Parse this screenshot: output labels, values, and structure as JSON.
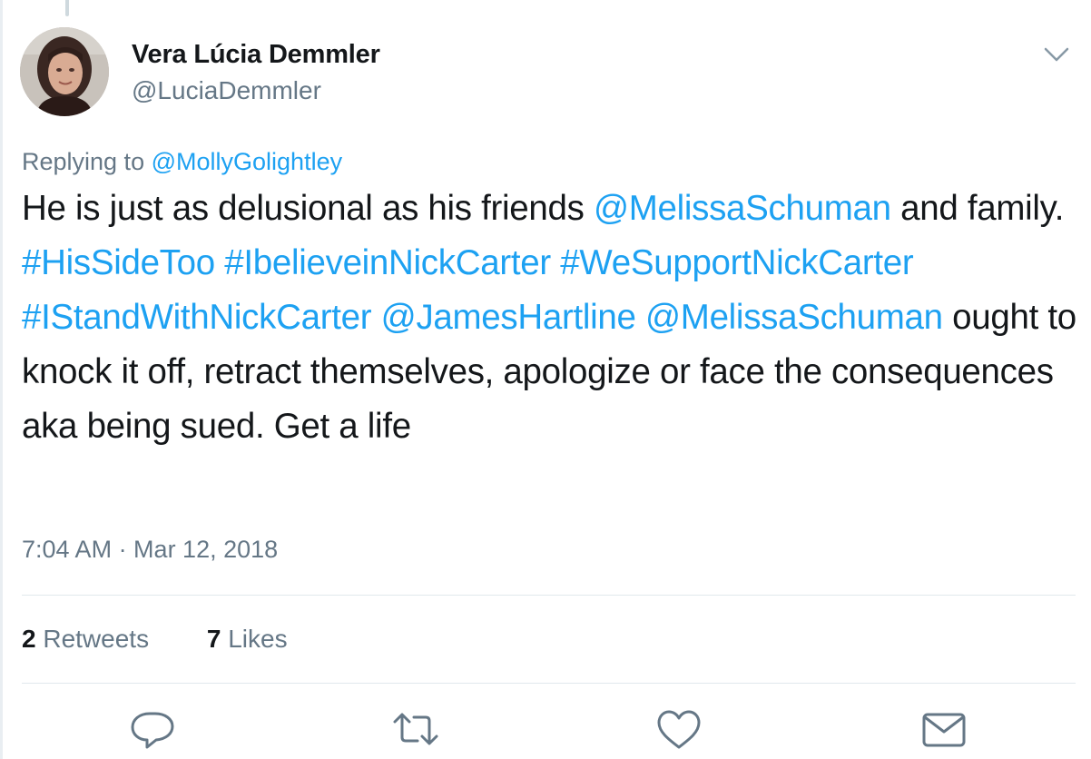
{
  "author": {
    "display_name": "Vera Lúcia Demmler",
    "handle": "@LuciaDemmler"
  },
  "reply_context": {
    "prefix": "Replying to",
    "target": "@MollyGolightley"
  },
  "tweet": {
    "segments": [
      {
        "text": "He is just as delusional as his friends ",
        "link": false
      },
      {
        "text": "@MelissaSchuman",
        "link": true
      },
      {
        "text": " and family. ",
        "link": false
      },
      {
        "text": "#HisSideToo",
        "link": true
      },
      {
        "text": " ",
        "link": false
      },
      {
        "text": "#IbelieveinNickCarter",
        "link": true
      },
      {
        "text": " ",
        "link": false
      },
      {
        "text": "#WeSupportNickCarter",
        "link": true
      },
      {
        "text": " ",
        "link": false
      },
      {
        "text": "#IStandWithNickCarter",
        "link": true
      },
      {
        "text": " ",
        "link": false
      },
      {
        "text": "@JamesHartline",
        "link": true
      },
      {
        "text": " ",
        "link": false
      },
      {
        "text": "@MelissaSchuman",
        "link": true
      },
      {
        "text": " ought to knock it off, retract themselves, apologize or face the consequences aka being sued. Get a life",
        "link": false
      }
    ]
  },
  "timestamp": "7:04 AM · Mar 12, 2018",
  "stats": {
    "retweets_count": "2",
    "retweets_label": "Retweets",
    "likes_count": "7",
    "likes_label": "Likes"
  },
  "actions": {
    "reply_icon": "reply-icon",
    "retweet_icon": "retweet-icon",
    "like_icon": "heart-icon",
    "dm_icon": "envelope-icon"
  },
  "colors": {
    "link": "#1da1f2",
    "secondary_text": "#657786",
    "primary_text": "#14171a",
    "divider": "#e1e8ed"
  }
}
